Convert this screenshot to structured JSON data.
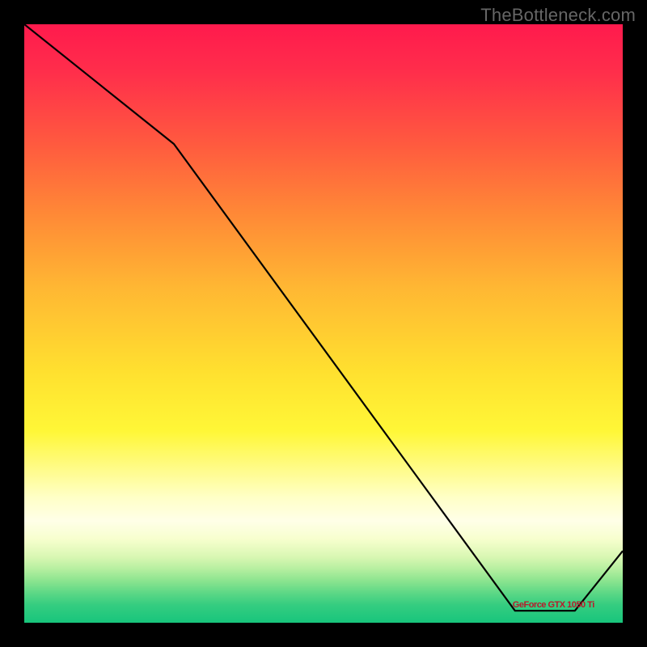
{
  "attribution": "TheBottleneck.com",
  "chart_data": {
    "type": "line",
    "title": "",
    "xlabel": "",
    "ylabel": "",
    "xlim": [
      0,
      100
    ],
    "ylim": [
      0,
      100
    ],
    "series": [
      {
        "name": "bottleneck-curve",
        "label": "GeForce GTX 1050 Ti",
        "x": [
          0,
          25,
          82,
          88,
          92,
          100
        ],
        "values": [
          100,
          80,
          2,
          2,
          2,
          12
        ]
      }
    ],
    "background_gradient": {
      "type": "vertical",
      "stops": [
        {
          "pos": 0.0,
          "color": "#ff1a4d"
        },
        {
          "pos": 0.2,
          "color": "#ff5a3f"
        },
        {
          "pos": 0.44,
          "color": "#ffb733"
        },
        {
          "pos": 0.68,
          "color": "#fff737"
        },
        {
          "pos": 0.83,
          "color": "#ffffe8"
        },
        {
          "pos": 1.0,
          "color": "#18c57c"
        }
      ]
    }
  }
}
